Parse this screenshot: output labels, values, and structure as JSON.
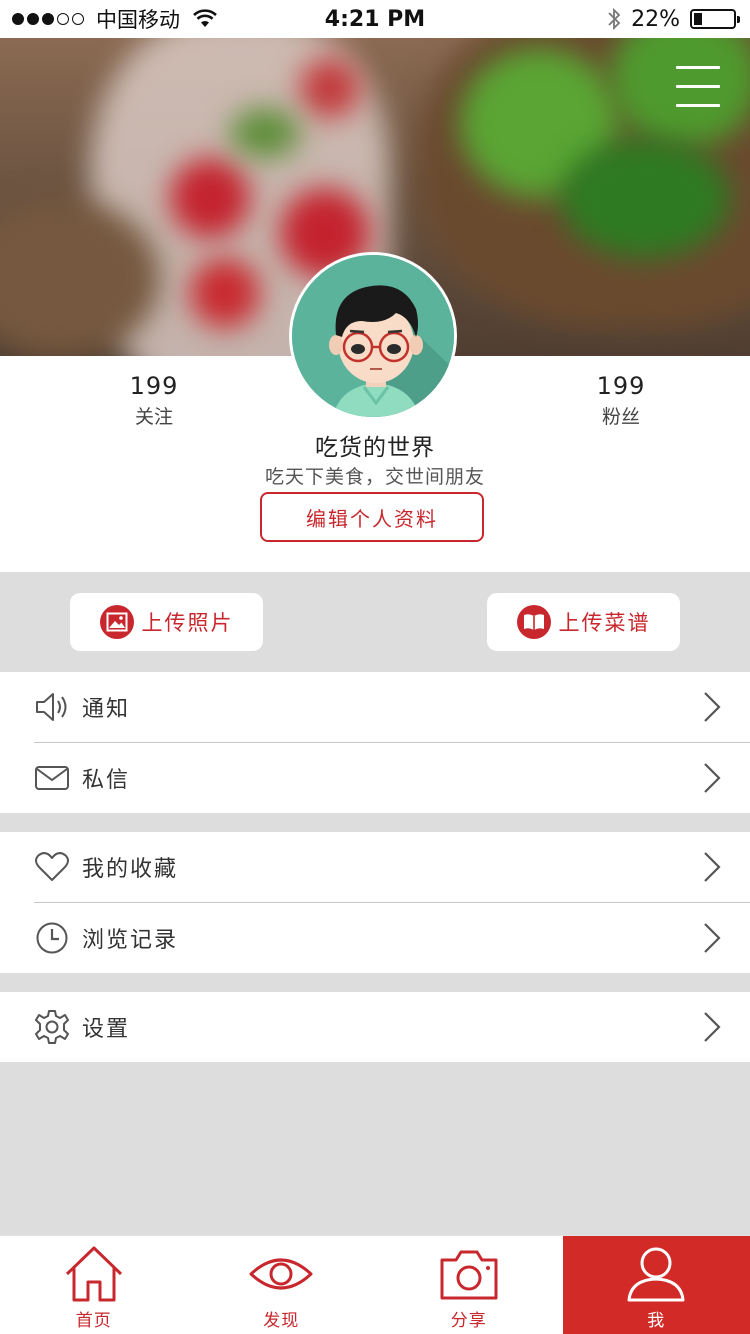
{
  "status_bar": {
    "carrier": "中国移动",
    "time": "4:21 PM",
    "battery": "22%",
    "battery_level": 0.22
  },
  "hero": {
    "menu_icon": "hamburger-menu-icon"
  },
  "profile": {
    "following_count": "199",
    "following_label": "关注",
    "followers_count": "199",
    "followers_label": "粉丝",
    "nickname": "吃货的世界",
    "bio": "吃天下美食，交世间朋友",
    "edit_button": "编辑个人资料",
    "avatar": "avatar-cartoon-boy-glasses"
  },
  "actions": {
    "upload_photo": "上传照片",
    "upload_recipe": "上传菜谱"
  },
  "menu": {
    "notifications": "通知",
    "messages": "私信",
    "favorites": "我的收藏",
    "history": "浏览记录",
    "settings": "设置"
  },
  "tabbar": {
    "tabs": [
      {
        "label": "首页",
        "icon": "home-icon"
      },
      {
        "label": "发现",
        "icon": "eye-icon"
      },
      {
        "label": "分享",
        "icon": "camera-icon"
      },
      {
        "label": "我",
        "icon": "person-icon",
        "active": true
      }
    ]
  },
  "colors": {
    "accent": "#c8282d",
    "background": "#dddddd",
    "active_tab": "#d12a27"
  }
}
